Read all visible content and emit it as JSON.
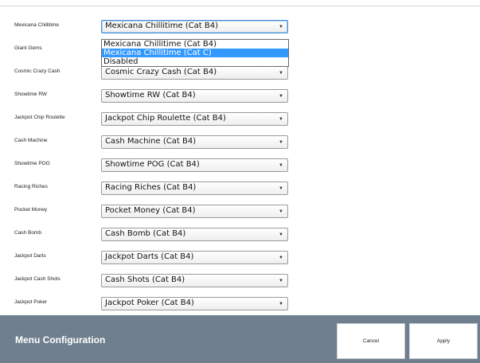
{
  "rows": [
    {
      "label": "Mexicana Chillitime",
      "value": "Mexicana Chillitime (Cat B4)"
    },
    {
      "label": "Giant Gems",
      "value": ""
    },
    {
      "label": "Cosmic Crazy Cash",
      "value": "Cosmic Crazy Cash (Cat B4)"
    },
    {
      "label": "Showtime RW",
      "value": "Showtime RW (Cat B4)"
    },
    {
      "label": "Jackpot Chip Roulette",
      "value": "Jackpot Chip Roulette (Cat B4)"
    },
    {
      "label": "Cash Machine",
      "value": "Cash Machine (Cat B4)"
    },
    {
      "label": "Showtime POG",
      "value": "Showtime POG (Cat B4)"
    },
    {
      "label": "Racing Riches",
      "value": "Racing Riches (Cat B4)"
    },
    {
      "label": "Pocket Money",
      "value": "Pocket Money (Cat B4)"
    },
    {
      "label": "Cash Bomb",
      "value": "Cash Bomb (Cat B4)"
    },
    {
      "label": "Jackpot Darts",
      "value": "Jackpot Darts (Cat B4)"
    },
    {
      "label": "Jackpot Cash Shots",
      "value": "Cash Shots (Cat B4)"
    },
    {
      "label": "Jackpot Poker",
      "value": "Jackpot Poker (Cat B4)"
    }
  ],
  "dropdown": {
    "options": [
      "Mexicana Chillitime (Cat B4)",
      "Mexicana Chillitime (Cat C)",
      "Disabled"
    ],
    "highlighted_index": 1
  },
  "footer": {
    "title": "Menu Configuration",
    "cancel_label": "Cancel",
    "apply_label": "Apply"
  },
  "colors": {
    "footer_bg": "#6f7f8e",
    "highlight": "#3399ff"
  },
  "icons": {
    "dropdown_caret": "chevron-down-icon"
  }
}
